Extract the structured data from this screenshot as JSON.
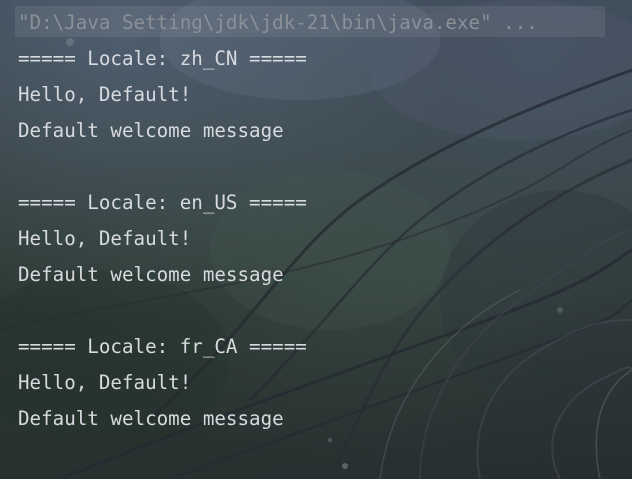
{
  "console": {
    "command": "\"D:\\Java Setting\\jdk\\jdk-21\\bin\\java.exe\" ...",
    "blocks": [
      {
        "header": "===== Locale: zh_CN =====",
        "greeting": "Hello, Default!",
        "message": "Default welcome message"
      },
      {
        "header": "===== Locale: en_US =====",
        "greeting": "Hello, Default!",
        "message": "Default welcome message"
      },
      {
        "header": "===== Locale: fr_CA =====",
        "greeting": "Hello, Default!",
        "message": "Default welcome message"
      }
    ]
  },
  "colors": {
    "text": "#d7dadf",
    "command_text": "#8c9097"
  }
}
